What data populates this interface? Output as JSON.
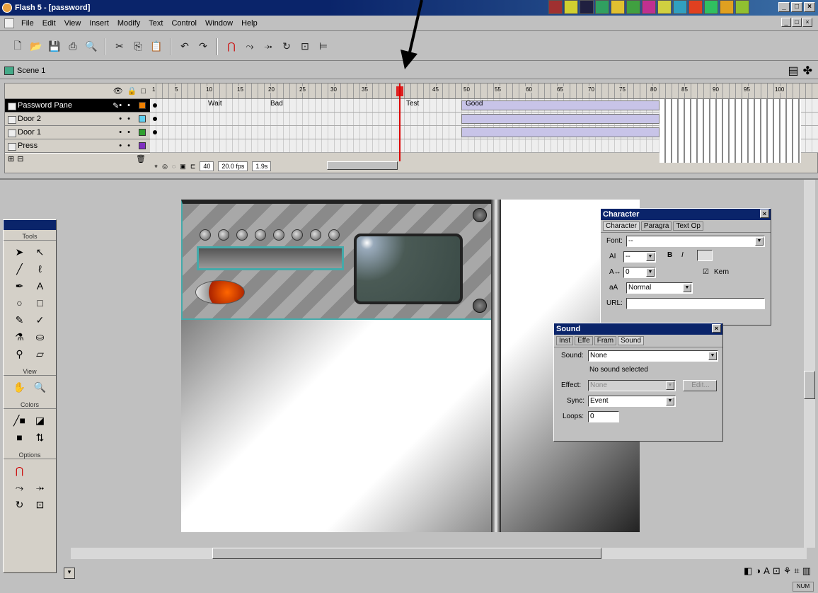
{
  "window": {
    "title": "Flash 5 - [password]",
    "minimize": "_",
    "maximize": "□",
    "close": "×"
  },
  "menu": [
    "File",
    "Edit",
    "View",
    "Insert",
    "Modify",
    "Text",
    "Control",
    "Window",
    "Help"
  ],
  "toolbar": {
    "icons": [
      "new-icon",
      "open-icon",
      "save-icon",
      "print-icon",
      "print-preview-icon",
      "cut-icon",
      "copy-icon",
      "paste-icon",
      "undo-icon",
      "redo-icon",
      "snap-icon",
      "smooth-icon",
      "straighten-icon",
      "rotate-icon",
      "scale-icon",
      "align-icon"
    ]
  },
  "scene": {
    "label": "Scene 1"
  },
  "timeline": {
    "layers": [
      {
        "name": "Password Pane",
        "selected": true,
        "color": "#f08000"
      },
      {
        "name": "Door 2",
        "selected": false,
        "color": "#60d0f0"
      },
      {
        "name": "Door 1",
        "selected": false,
        "color": "#30a030"
      },
      {
        "name": "Press",
        "selected": false,
        "color": "#8030c0"
      }
    ],
    "ruler": [
      "1",
      "5",
      "10",
      "15",
      "20",
      "25",
      "30",
      "35",
      "40",
      "45",
      "50",
      "55",
      "60",
      "65",
      "70",
      "75",
      "80",
      "85",
      "90",
      "95",
      "100"
    ],
    "labels": [
      "Wait",
      "Bad",
      "Test",
      "Good"
    ],
    "current_frame": "40",
    "fps": "20.0 fps",
    "elapsed": "1.9s"
  },
  "tools": {
    "title": "Tools",
    "view": "View",
    "colors": "Colors",
    "options": "Options"
  },
  "character_panel": {
    "title": "Character",
    "tabs": [
      "Character",
      "Paragra",
      "Text Op"
    ],
    "font_label": "Font:",
    "font_value": "--",
    "size_value": "--",
    "tracking_value": "0",
    "kern_label": "Kern",
    "baseline_value": "Normal",
    "url_label": "URL:",
    "url_value": ""
  },
  "sound_panel": {
    "title": "Sound",
    "tabs": [
      "Inst",
      "Effe",
      "Fram",
      "Sound"
    ],
    "sound_label": "Sound:",
    "sound_value": "None",
    "status": "No sound selected",
    "effect_label": "Effect:",
    "effect_value": "None",
    "edit_label": "Edit...",
    "sync_label": "Sync:",
    "sync_value": "Event",
    "loops_label": "Loops:",
    "loops_value": "0"
  },
  "status": {
    "zoom": "NUM"
  }
}
